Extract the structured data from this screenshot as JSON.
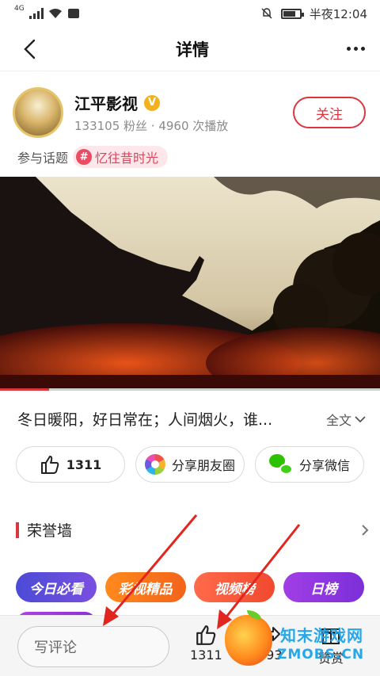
{
  "status_bar": {
    "network": "4G",
    "time": "半夜12:04"
  },
  "header": {
    "title": "详情"
  },
  "author": {
    "name": "江平影视",
    "stats": "133105 粉丝 · 4960 次播放",
    "follow_label": "关注"
  },
  "topic": {
    "label": "参与话题",
    "tag": "忆往昔时光"
  },
  "video": {
    "progress_fraction": 0.13
  },
  "caption": {
    "text": "冬日暖阳，好日常在；人间烟火，谁...",
    "expand_label": "全文"
  },
  "actions": {
    "like_count": "1311",
    "moments_label": "分享朋友圈",
    "wechat_label": "分享微信"
  },
  "honor": {
    "title": "荣誉墙",
    "badges": [
      "今日必看",
      "彩视精品",
      "视频榜",
      "日榜"
    ]
  },
  "bottom_bar": {
    "comment_placeholder": "写评论",
    "like_count": "1311",
    "share_count": "893",
    "reward_label": "赞赏"
  },
  "watermark": {
    "name": "知末游戏网",
    "url": "ZMOBS.CN"
  },
  "colors": {
    "accent": "#d9363e",
    "topic": "#e2435a",
    "arrow": "#e0261f"
  }
}
